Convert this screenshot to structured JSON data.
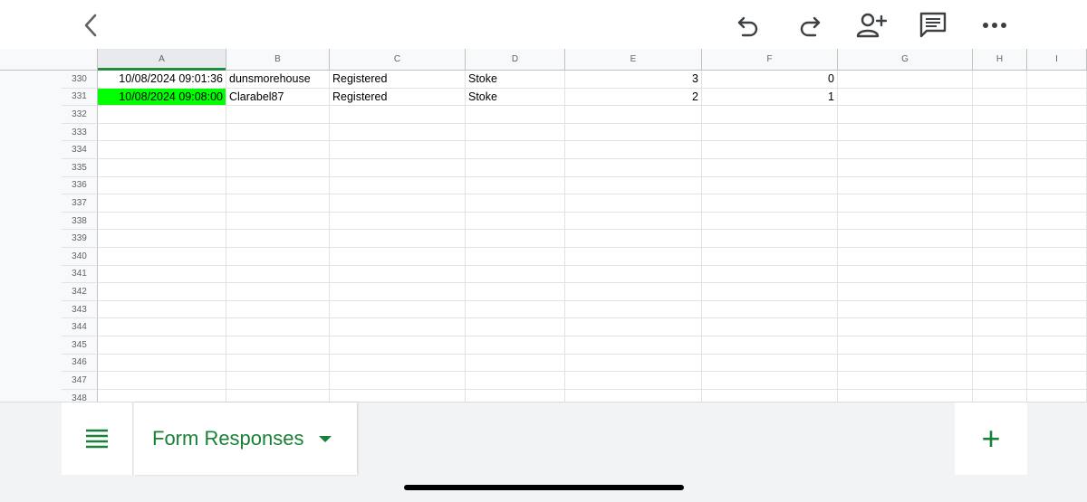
{
  "toolbar": {
    "back_icon": "chevron-left-icon",
    "undo_icon": "undo-icon",
    "redo_icon": "redo-icon",
    "share_icon": "add-person-icon",
    "comment_icon": "comment-icon",
    "more_icon": "more-dots-icon"
  },
  "columns": [
    "A",
    "B",
    "C",
    "D",
    "E",
    "F",
    "G",
    "H",
    "I"
  ],
  "selected_column": "A",
  "rows": [
    {
      "num": "330",
      "cells": [
        "10/08/2024 09:01:36",
        "dunsmorehouse",
        "Registered",
        "Stoke",
        "3",
        "0",
        "",
        "",
        ""
      ],
      "highlight_a": false
    },
    {
      "num": "331",
      "cells": [
        "10/08/2024 09:08:00",
        "Clarabel87",
        "Registered",
        "Stoke",
        "2",
        "1",
        "",
        "",
        ""
      ],
      "highlight_a": true
    },
    {
      "num": "332",
      "cells": [
        "",
        "",
        "",
        "",
        "",
        "",
        "",
        "",
        ""
      ]
    },
    {
      "num": "333",
      "cells": [
        "",
        "",
        "",
        "",
        "",
        "",
        "",
        "",
        ""
      ]
    },
    {
      "num": "334",
      "cells": [
        "",
        "",
        "",
        "",
        "",
        "",
        "",
        "",
        ""
      ]
    },
    {
      "num": "335",
      "cells": [
        "",
        "",
        "",
        "",
        "",
        "",
        "",
        "",
        ""
      ]
    },
    {
      "num": "336",
      "cells": [
        "",
        "",
        "",
        "",
        "",
        "",
        "",
        "",
        ""
      ]
    },
    {
      "num": "337",
      "cells": [
        "",
        "",
        "",
        "",
        "",
        "",
        "",
        "",
        ""
      ]
    },
    {
      "num": "338",
      "cells": [
        "",
        "",
        "",
        "",
        "",
        "",
        "",
        "",
        ""
      ]
    },
    {
      "num": "339",
      "cells": [
        "",
        "",
        "",
        "",
        "",
        "",
        "",
        "",
        ""
      ]
    },
    {
      "num": "340",
      "cells": [
        "",
        "",
        "",
        "",
        "",
        "",
        "",
        "",
        ""
      ]
    },
    {
      "num": "341",
      "cells": [
        "",
        "",
        "",
        "",
        "",
        "",
        "",
        "",
        ""
      ]
    },
    {
      "num": "342",
      "cells": [
        "",
        "",
        "",
        "",
        "",
        "",
        "",
        "",
        ""
      ]
    },
    {
      "num": "343",
      "cells": [
        "",
        "",
        "",
        "",
        "",
        "",
        "",
        "",
        ""
      ]
    },
    {
      "num": "344",
      "cells": [
        "",
        "",
        "",
        "",
        "",
        "",
        "",
        "",
        ""
      ]
    },
    {
      "num": "345",
      "cells": [
        "",
        "",
        "",
        "",
        "",
        "",
        "",
        "",
        ""
      ]
    },
    {
      "num": "346",
      "cells": [
        "",
        "",
        "",
        "",
        "",
        "",
        "",
        "",
        ""
      ]
    },
    {
      "num": "347",
      "cells": [
        "",
        "",
        "",
        "",
        "",
        "",
        "",
        "",
        ""
      ]
    },
    {
      "num": "348",
      "cells": [
        "",
        "",
        "",
        "",
        "",
        "",
        "",
        "",
        ""
      ]
    }
  ],
  "sheet_tab": {
    "label": "Form Responses"
  },
  "bottom": {
    "add_label": "+"
  },
  "colors": {
    "accent": "#188038",
    "highlight": "#00ff00"
  }
}
